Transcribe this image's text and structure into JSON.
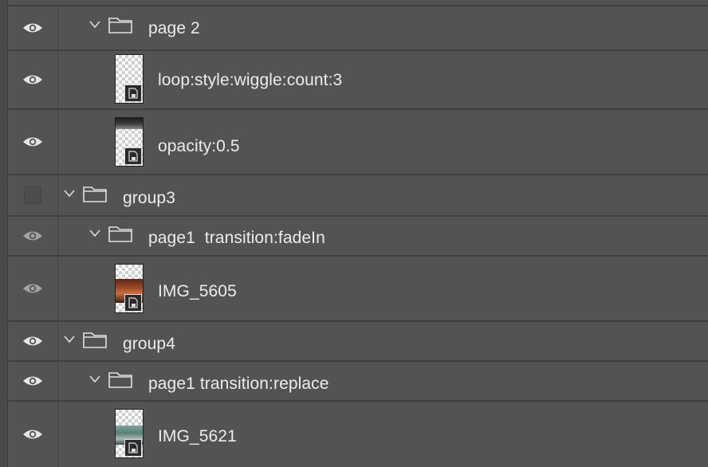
{
  "panel": {
    "name": "layers-panel"
  },
  "layers": [
    {
      "id": "page-2",
      "type": "group",
      "label": "page 2",
      "visible": true,
      "dim": false,
      "depth": 1
    },
    {
      "id": "loop-style",
      "type": "smart-object",
      "label": "loop:style:wiggle:count:3",
      "visible": true,
      "dim": false,
      "thumb": "transparent"
    },
    {
      "id": "opacity",
      "type": "smart-object",
      "label": "opacity:0.5",
      "visible": true,
      "dim": false,
      "thumb": "top-dark"
    },
    {
      "id": "group3",
      "type": "group",
      "label": "group3",
      "visible": false,
      "dim": false,
      "depth": 0
    },
    {
      "id": "page1-fadein",
      "type": "group",
      "label": "page1  transition:fadeIn",
      "visible": true,
      "dim": true,
      "depth": 1
    },
    {
      "id": "img-5605",
      "type": "smart-object",
      "label": "IMG_5605",
      "visible": true,
      "dim": true,
      "thumb": "photo-warm"
    },
    {
      "id": "group4",
      "type": "group",
      "label": "group4",
      "visible": true,
      "dim": false,
      "depth": 0
    },
    {
      "id": "page1-replace",
      "type": "group",
      "label": "page1 transition:replace",
      "visible": true,
      "dim": false,
      "depth": 1
    },
    {
      "id": "img-5621",
      "type": "smart-object",
      "label": "IMG_5621",
      "visible": true,
      "dim": false,
      "thumb": "photo-cool"
    }
  ],
  "colors": {
    "panel_bg": "#535353",
    "divider": "#3f3f3f",
    "text": "#ececec"
  },
  "icons": {
    "visibility": "eye-icon",
    "hidden_visibility": "empty-visibility-box",
    "disclosure": "chevron-down-icon",
    "group": "folder-icon",
    "smart_object": "smart-object-badge-icon"
  }
}
